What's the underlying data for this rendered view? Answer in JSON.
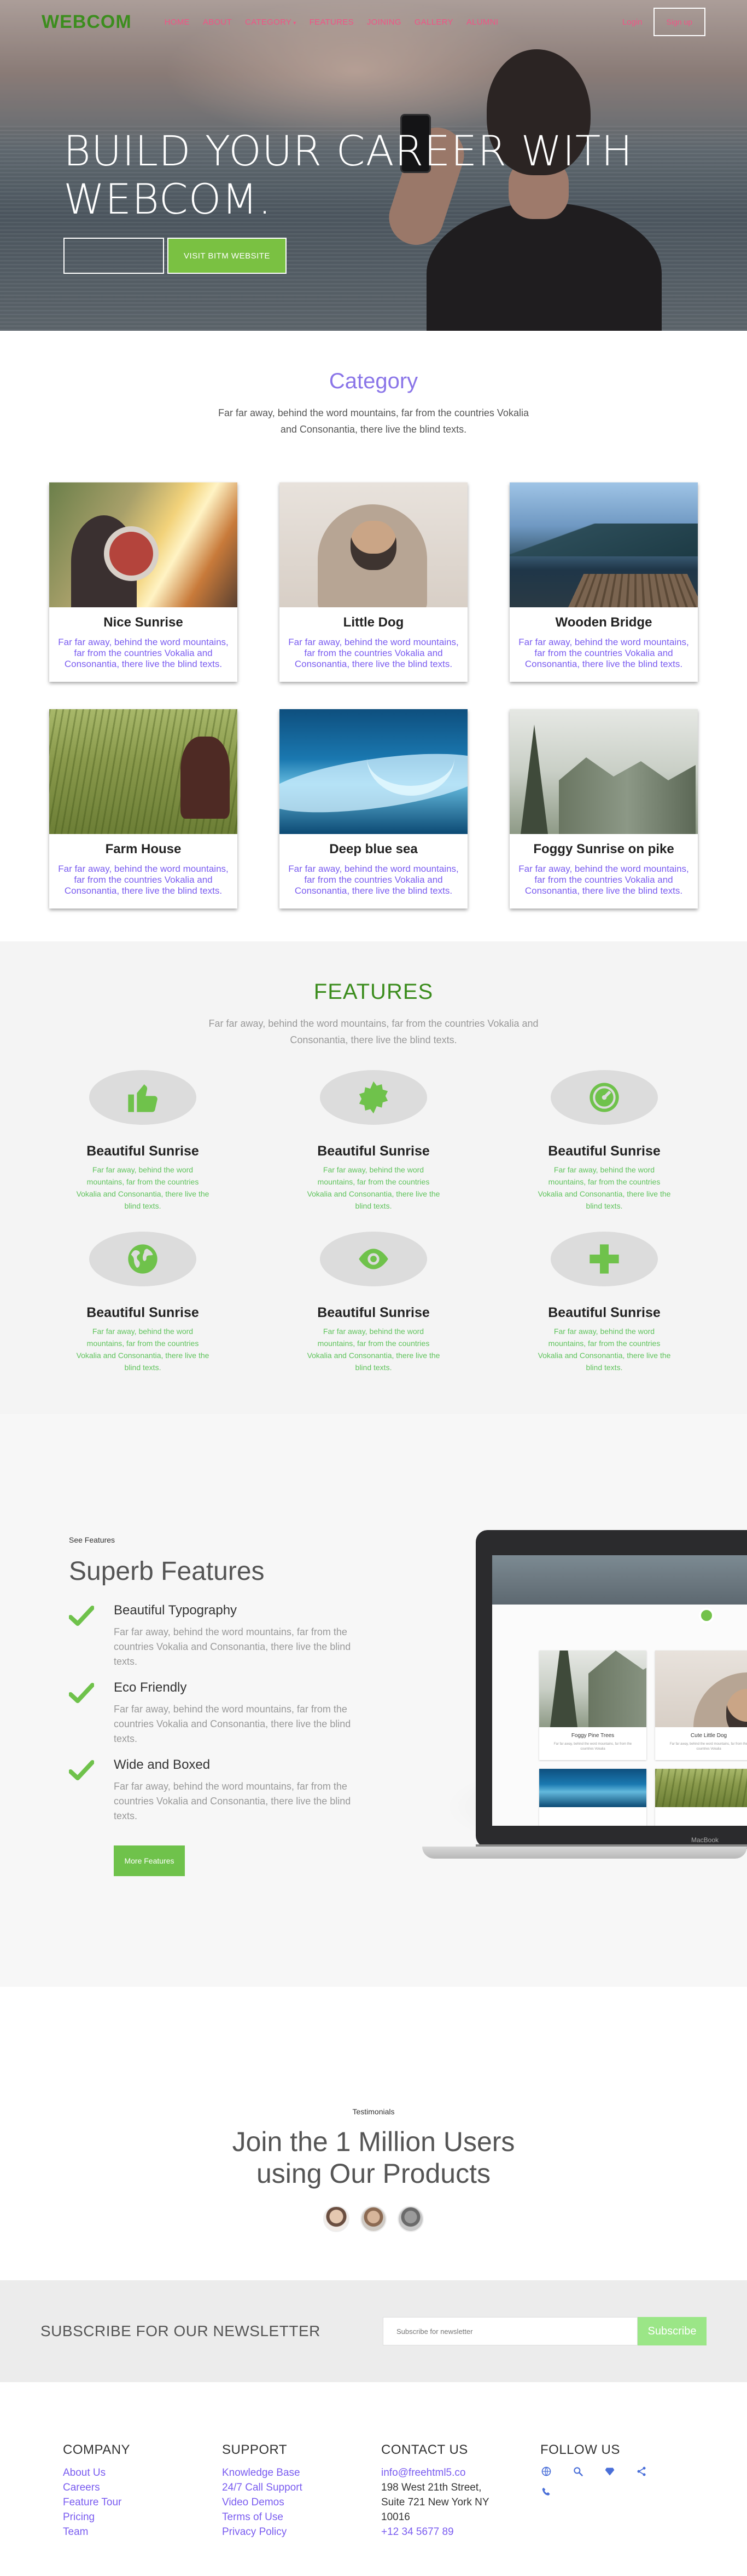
{
  "nav": {
    "logo": "WEBCOM",
    "menu": [
      "HOME",
      "ABOUT",
      "CATEGORY",
      "FEATURES",
      "JOINING",
      "GALLERY",
      "ALUMNI"
    ],
    "login": "Login",
    "signup": "Sign up"
  },
  "hero": {
    "title_line1": "BUILD YOUR CAREER WITH",
    "title_line2": "WEBCOM.",
    "btn_outline": "",
    "btn_primary": "VISIT BITM WEBSITE"
  },
  "category": {
    "title": "Category",
    "subtitle": "Far far away, behind the word mountains, far from the countries Vokalia and Consonantia, there live the blind texts.",
    "cards": [
      {
        "title": "Nice Sunrise",
        "text": "Far far away, behind the word mountains, far from the countries Vokalia and Consonantia, there live the blind texts."
      },
      {
        "title": "Little Dog",
        "text": "Far far away, behind the word mountains, far from the countries Vokalia and Consonantia, there live the blind texts."
      },
      {
        "title": "Wooden Bridge",
        "text": "Far far away, behind the word mountains, far from the countries Vokalia and Consonantia, there live the blind texts."
      },
      {
        "title": "Farm House",
        "text": "Far far away, behind the word mountains, far from the countries Vokalia and Consonantia, there live the blind texts."
      },
      {
        "title": "Deep blue sea",
        "text": "Far far away, behind the word mountains, far from the countries Vokalia and Consonantia, there live the blind texts."
      },
      {
        "title": "Foggy Sunrise on pike",
        "text": "Far far away, behind the word mountains, far from the countries Vokalia and Consonantia, there live the blind texts."
      }
    ]
  },
  "features": {
    "title": "FEATURES",
    "subtitle": "Far far away, behind the word mountains, far from the countries Vokalia and Consonantia, there live the blind texts.",
    "items": [
      {
        "icon": "thumbs-up-icon",
        "title": "Beautiful Sunrise",
        "text": "Far far away, behind the word mountains, far from the countries Vokalia and Consonantia, there live the blind texts."
      },
      {
        "icon": "badge-icon",
        "title": "Beautiful Sunrise",
        "text": "Far far away, behind the word mountains, far from the countries Vokalia and Consonantia, there live the blind texts."
      },
      {
        "icon": "dashboard-icon",
        "title": "Beautiful Sunrise",
        "text": "Far far away, behind the word mountains, far from the countries Vokalia and Consonantia, there live the blind texts."
      },
      {
        "icon": "globe-icon",
        "title": "Beautiful Sunrise",
        "text": "Far far away, behind the word mountains, far from the countries Vokalia and Consonantia, there live the blind texts."
      },
      {
        "icon": "eye-icon",
        "title": "Beautiful Sunrise",
        "text": "Far far away, behind the word mountains, far from the countries Vokalia and Consonantia, there live the blind texts."
      },
      {
        "icon": "plus-icon",
        "title": "Beautiful Sunrise",
        "text": "Far far away, behind the word mountains, far from the countries Vokalia and Consonantia, there live the blind texts."
      }
    ]
  },
  "superb": {
    "eyebrow": "See Features",
    "title": "Superb Features",
    "items": [
      {
        "title": "Beautiful Typography",
        "text": "Far far away, behind the word mountains, far from the countries Vokalia and Consonantia, there live the blind texts."
      },
      {
        "title": "Eco Friendly",
        "text": "Far far away, behind the word mountains, far from the countries Vokalia and Consonantia, there live the blind texts."
      },
      {
        "title": "Wide and Boxed",
        "text": "Far far away, behind the word mountains, far from the countries Vokalia and Consonantia, there live the blind texts."
      }
    ],
    "button": "More Features",
    "laptop": {
      "brand": "MacBook",
      "card1_title": "Foggy Pine Trees",
      "card1_text": "Far far away, behind the word mountains, far from the countries Vokalia",
      "card2_title": "Cute Little Dog",
      "card2_text": "Far far away, behind the word mountains, far from the countries Vokalia"
    }
  },
  "testimonials": {
    "eyebrow": "Testimonials",
    "title": "Join the 1 Million Users using Our Products"
  },
  "newsletter": {
    "title": "SUBSCRIBE FOR OUR NEWSLETTER",
    "placeholder": "Subscribe for newsletter",
    "button": "Subscribe"
  },
  "footer": {
    "company": {
      "title": "COMPANY",
      "links": [
        "About Us",
        "Careers",
        "Feature Tour",
        "Pricing",
        "Team"
      ]
    },
    "support": {
      "title": "SUPPORT",
      "links": [
        "Knowledge Base",
        "24/7 Call Support",
        "Video Demos",
        "Terms of Use",
        "Privacy Policy"
      ]
    },
    "contact": {
      "title": "CONTACT US",
      "email": "info@freehtml5.co",
      "lines": [
        "198 West 21th Street,",
        "Suite 721 New York NY",
        "10016",
        "+12 34 5677 89"
      ]
    },
    "follow": {
      "title": "FOLLOW US",
      "icons": [
        "globe-icon",
        "search-icon",
        "diamond-icon",
        "share-icon",
        "phone-icon"
      ]
    }
  },
  "colors": {
    "brand_green": "#3c8d1e",
    "accent_purple": "#8a75e8",
    "nav_pink": "#f05486",
    "button_green": "#7ac142"
  }
}
